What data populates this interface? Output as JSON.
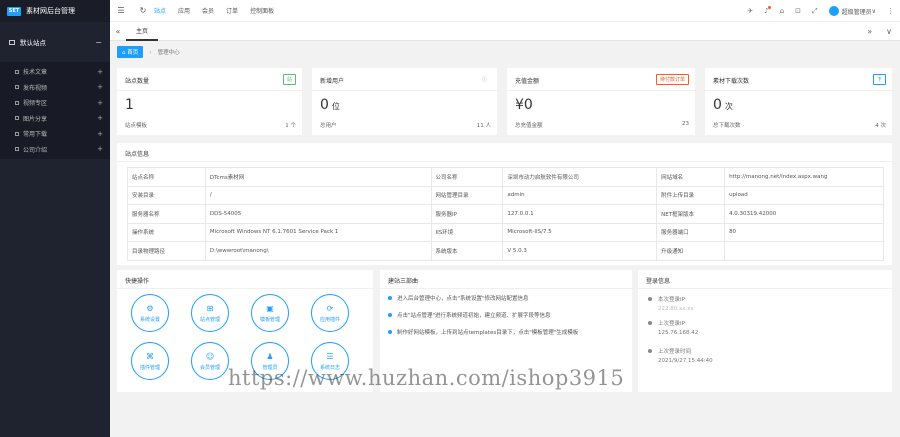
{
  "sidebar": {
    "logo_badge": "SET",
    "logo_text": "素材网后台管理",
    "site_title": "默认站点",
    "items": [
      {
        "label": "技术文章"
      },
      {
        "label": "发布视频"
      },
      {
        "label": "视频专区"
      },
      {
        "label": "图片分享"
      },
      {
        "label": "常用下载"
      },
      {
        "label": "公司介绍"
      }
    ]
  },
  "topbar": {
    "nav": [
      "站点",
      "应用",
      "会员",
      "订单",
      "控制面板"
    ],
    "user_name": "超级管理员"
  },
  "tabs": {
    "home_label": "主页"
  },
  "breadcrumb": {
    "home": "首页",
    "current": "管理中心"
  },
  "stats": [
    {
      "title": "站点数量",
      "badge": "站",
      "badge_color": "#5fb878",
      "value": "1",
      "unit": "",
      "foot_left": "站点模板",
      "foot_right": "1 个"
    },
    {
      "title": "新增用户",
      "badge": "ⓘ",
      "badge_color": "#999999",
      "value": "0",
      "unit": "位",
      "foot_left": "总用户",
      "foot_right": "11 人"
    },
    {
      "title": "充值金额",
      "badge": "待付款订单",
      "badge_color": "#ff5722",
      "value": "¥0",
      "unit": "",
      "foot_left": "总充值金额",
      "foot_right": "23"
    },
    {
      "title": "素材下载次数",
      "badge": "下",
      "badge_color": "#1e9fff",
      "value": "0",
      "unit": "次",
      "foot_left": "总下载次数",
      "foot_right": "4 次"
    }
  ],
  "sysinfo": {
    "title": "站点信息",
    "rows": [
      [
        "站点名称",
        "DTcms素材网",
        "公司名称",
        "深圳市动力启航软件有限公司",
        "网站域名",
        "http://manong.net/index.aspx.wang"
      ],
      [
        "安装目录",
        "/",
        "网站管理目录",
        "admin",
        "附件上传目录",
        "upload"
      ],
      [
        "服务器名称",
        "DDS-54005",
        "服务器IP",
        "127.0.0.1",
        "NET框架版本",
        "4.0.30319.42000"
      ],
      [
        "操作系统",
        "Microsoft Windows NT 6.1.7601 Service Pack 1",
        "IIS环境",
        "Microsoft-IIS/7.5",
        "服务器端口",
        "80"
      ],
      [
        "目录物理路径",
        "D:\\wwwroot\\manong\\",
        "系统版本",
        "V 5.0.3",
        "升级通知",
        ""
      ]
    ]
  },
  "quick": {
    "title": "快捷操作",
    "items": [
      {
        "label": "系统设置",
        "icon": "gear-icon",
        "glyph": "⚙"
      },
      {
        "label": "站点管理",
        "icon": "sitemap-icon",
        "glyph": "⊞"
      },
      {
        "label": "模板管理",
        "icon": "template-icon",
        "glyph": "▣"
      },
      {
        "label": "应用插件",
        "icon": "plugin-icon",
        "glyph": "⟳"
      },
      {
        "label": "插件管理",
        "icon": "puzzle-icon",
        "glyph": "⌘"
      },
      {
        "label": "会员管理",
        "icon": "user-icon",
        "glyph": "☺"
      },
      {
        "label": "管理员",
        "icon": "admin-icon",
        "glyph": "♟"
      },
      {
        "label": "系统日志",
        "icon": "log-icon",
        "glyph": "☰"
      }
    ]
  },
  "guide": {
    "title": "建站三部曲",
    "items": [
      "进入后台管理中心，点击\"系统设置\"修改网站配置信息",
      "点击\"站点管理\"进行系统频道初始，建立频道、扩展字段等信息",
      "制作好网站模板，上传到站点templates目录下，点击\"模板管理\"生成模板"
    ]
  },
  "login": {
    "title": "登录信息",
    "items": [
      {
        "label": "本次登录IP",
        "value": "222.80.xx.xx"
      },
      {
        "label": "上次登录IP",
        "value": "125.76.168.42"
      },
      {
        "label": "上次登录时间",
        "value": "2021/9/27 15:44:40"
      }
    ]
  },
  "watermark": "https://www.huzhan.com/ishop3915"
}
